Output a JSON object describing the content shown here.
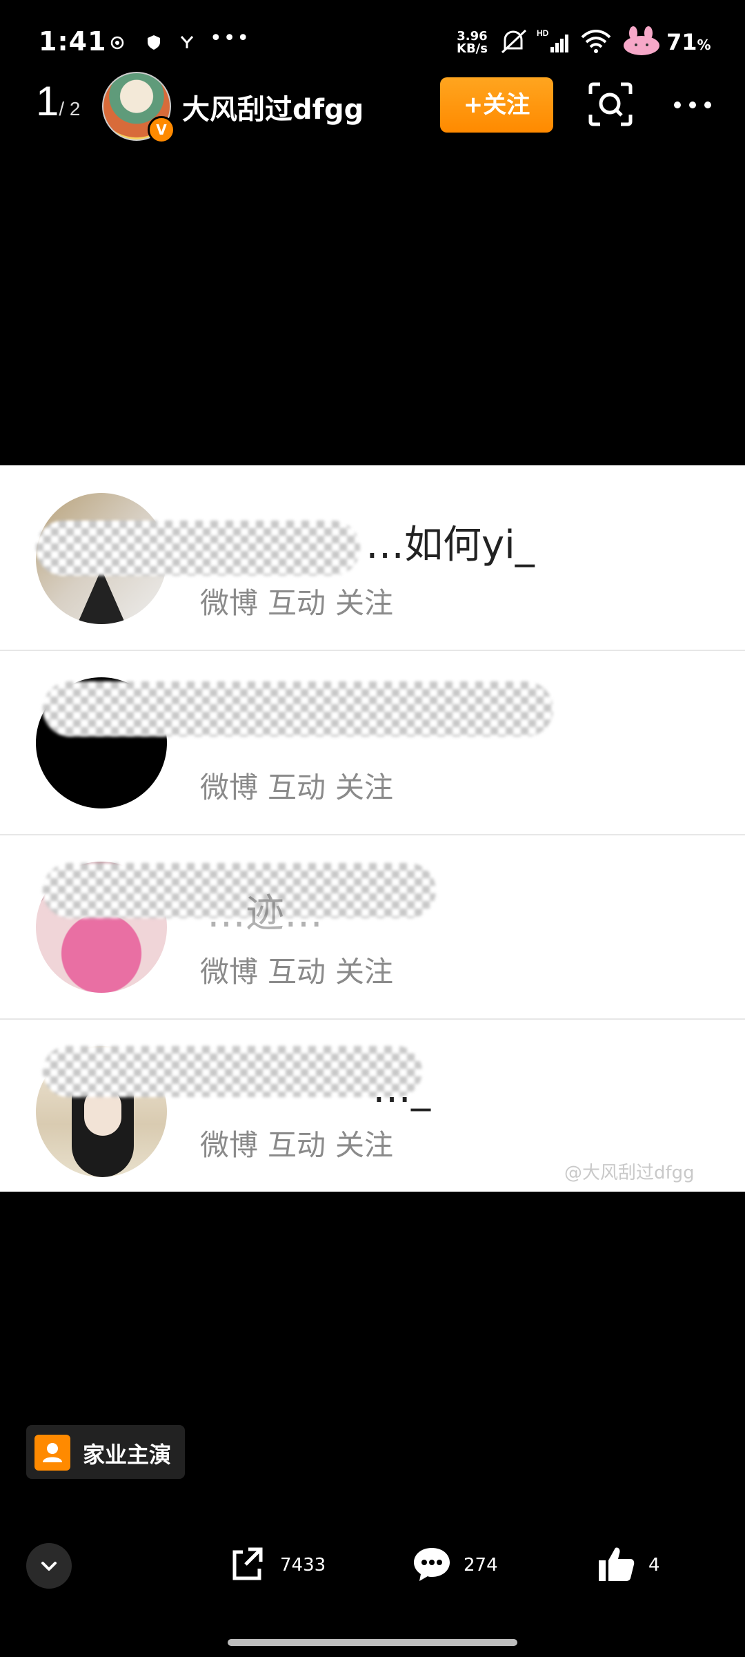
{
  "status_bar": {
    "time": "1:41",
    "more": "•••",
    "net_speed_value": "3.96",
    "net_speed_unit": "KB/s",
    "battery": "71",
    "battery_unit": "%"
  },
  "header": {
    "page_current": "1",
    "page_total": "/ 2",
    "verified_mark": "V",
    "username": "大风刮过dfgg",
    "follow_label": "+关注"
  },
  "post_image": {
    "rows": [
      {
        "name_visible": "…如何yi_",
        "actions": [
          "微博",
          "互动",
          "关注"
        ]
      },
      {
        "name_visible": "",
        "actions": [
          "微博",
          "互动",
          "关注"
        ]
      },
      {
        "name_visible": "…迹…",
        "actions": [
          "微博",
          "互动",
          "关注"
        ]
      },
      {
        "name_visible": "…_",
        "actions": [
          "微博",
          "互动",
          "关注"
        ]
      }
    ],
    "watermark": "@大风刮过dfgg"
  },
  "topic_tag": {
    "label": "家业主演"
  },
  "actions": {
    "share_count": "7433",
    "comment_count": "274",
    "like_count": "4"
  },
  "colors": {
    "accent": "#ff8a00",
    "background": "#000000"
  }
}
